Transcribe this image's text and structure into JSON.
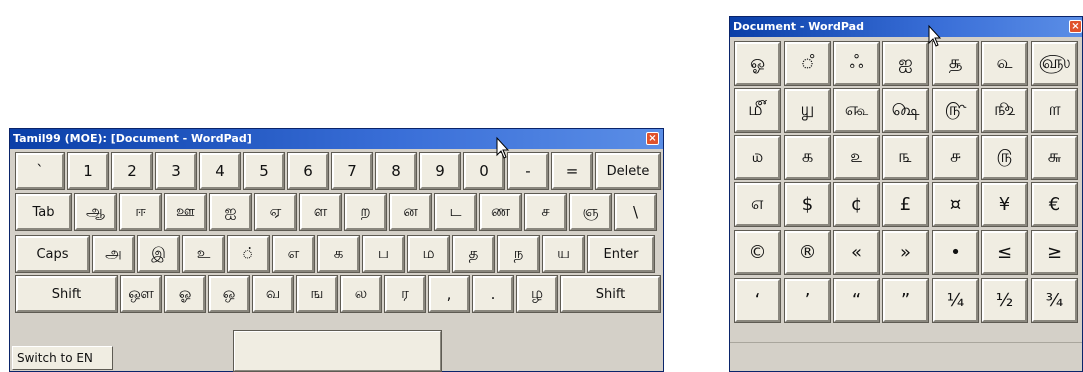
{
  "left_window": {
    "title": "Tamil99 (MOE): [Document - WordPad]",
    "close_glyph": "×",
    "rows": [
      [
        "`",
        "1",
        "2",
        "3",
        "4",
        "5",
        "6",
        "7",
        "8",
        "9",
        "0",
        "-",
        "=",
        "Delete"
      ],
      [
        "Tab",
        "ஆ",
        "ஈ",
        "ஊ",
        "ஐ",
        "ஏ",
        "ள",
        "ற",
        "ன",
        "ட",
        "ண",
        "ச",
        "ஞ",
        "\\"
      ],
      [
        "Caps",
        "அ",
        "இ",
        "உ",
        "்",
        "எ",
        "க",
        "ப",
        "ம",
        "த",
        "ந",
        "ய",
        "Enter"
      ],
      [
        "Shift",
        "ஔ",
        "ஓ",
        "ஒ",
        "வ",
        "ங",
        "ல",
        "ர",
        ",",
        ".",
        "ழ",
        "Shift"
      ]
    ],
    "switch_label": "Switch to EN"
  },
  "right_window": {
    "title": "Document - WordPad",
    "close_glyph": "×",
    "rows": [
      [
        "ஓ",
        "ஂ",
        "ஃ",
        "ஐ",
        "௲",
        "௳",
        "௵"
      ],
      [
        "௴",
        "௶",
        "௷",
        "௸",
        "௹",
        "௺",
        "௱"
      ],
      [
        "௰",
        "௧",
        "௨",
        "௩",
        "௪",
        "௫",
        "௬"
      ],
      [
        "௭",
        "$",
        "¢",
        "£",
        "¤",
        "¥",
        "€"
      ],
      [
        "©",
        "®",
        "«",
        "»",
        "•",
        "≤",
        "≥"
      ],
      [
        "‘",
        "’",
        "“",
        "”",
        "¼",
        "½",
        "¾"
      ]
    ]
  },
  "colors": {
    "titlebar": "#0a3fa8",
    "key_face": "#f0ede2",
    "window_bg": "#d4d0c8",
    "close": "#e0522c"
  }
}
